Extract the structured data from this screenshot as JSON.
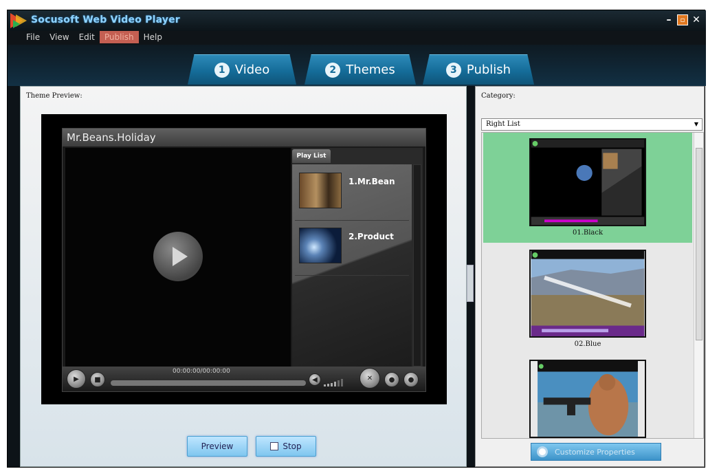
{
  "app": {
    "title": "Socusoft Web Video Player"
  },
  "menu": {
    "items": [
      "File",
      "View",
      "Edit",
      "Publish",
      "Help"
    ],
    "active": "Publish"
  },
  "tabs": [
    {
      "num": "1",
      "label": "Video"
    },
    {
      "num": "2",
      "label": "Themes"
    },
    {
      "num": "3",
      "label": "Publish"
    }
  ],
  "preview": {
    "label": "Theme Preview:",
    "player_title": "Mr.Beans.Holiday",
    "playlist_tab": "Play List",
    "playlist": [
      {
        "label": "1.Mr.Bean"
      },
      {
        "label": "2.Product"
      }
    ],
    "timecode": "00:00:00/00:00:00"
  },
  "buttons": {
    "preview": "Preview",
    "stop": "Stop"
  },
  "category": {
    "label": "Category:",
    "selected": "Right List"
  },
  "themes": [
    {
      "label": "01.Black",
      "selected": true
    },
    {
      "label": "02.Blue",
      "selected": false
    },
    {
      "label": "",
      "selected": false
    }
  ],
  "customize": {
    "label": "Customize Properties"
  },
  "colors": {
    "tab_blue": "#156c99",
    "selected_green": "#7ed197",
    "menu_active": "#c45f52"
  }
}
